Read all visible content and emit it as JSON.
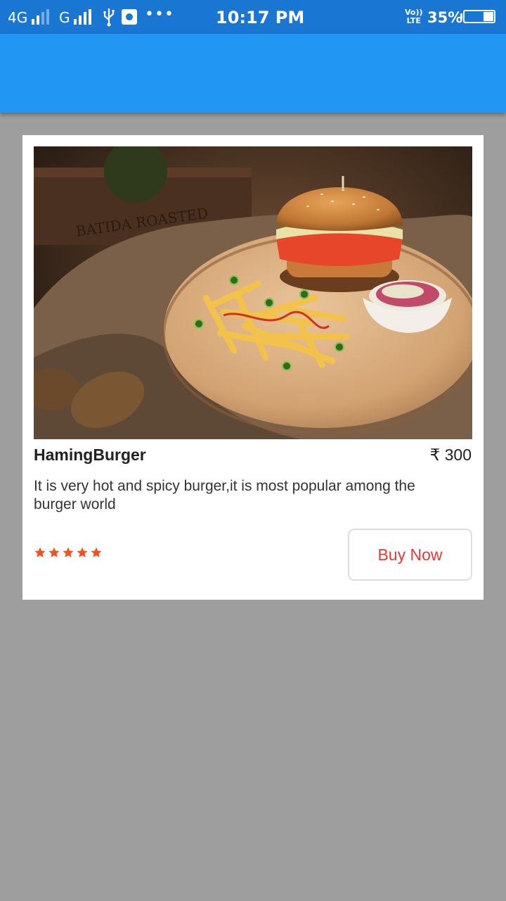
{
  "status_bar": {
    "network_4g": "4G",
    "network_g": "G",
    "more": "•••",
    "time": "10:17 PM",
    "volte_top": "Vo))",
    "volte_bottom": "LTE",
    "battery_percent": "35%",
    "battery_level": 0.35
  },
  "product": {
    "name": "HamingBurger",
    "price": "₹ 300",
    "description": "It is very hot and spicy burger,it is most popular among the burger world",
    "rating": 5,
    "rating_max": 5,
    "buy_label": "Buy Now",
    "image": "burger-with-fries-photo",
    "crate_text": "BATIDA ROASTED"
  },
  "colors": {
    "status_bar": "#1976d2",
    "app_bar": "#2196f3",
    "background": "#9e9e9e",
    "star": "#f4511e",
    "buy_text": "#e53935"
  }
}
